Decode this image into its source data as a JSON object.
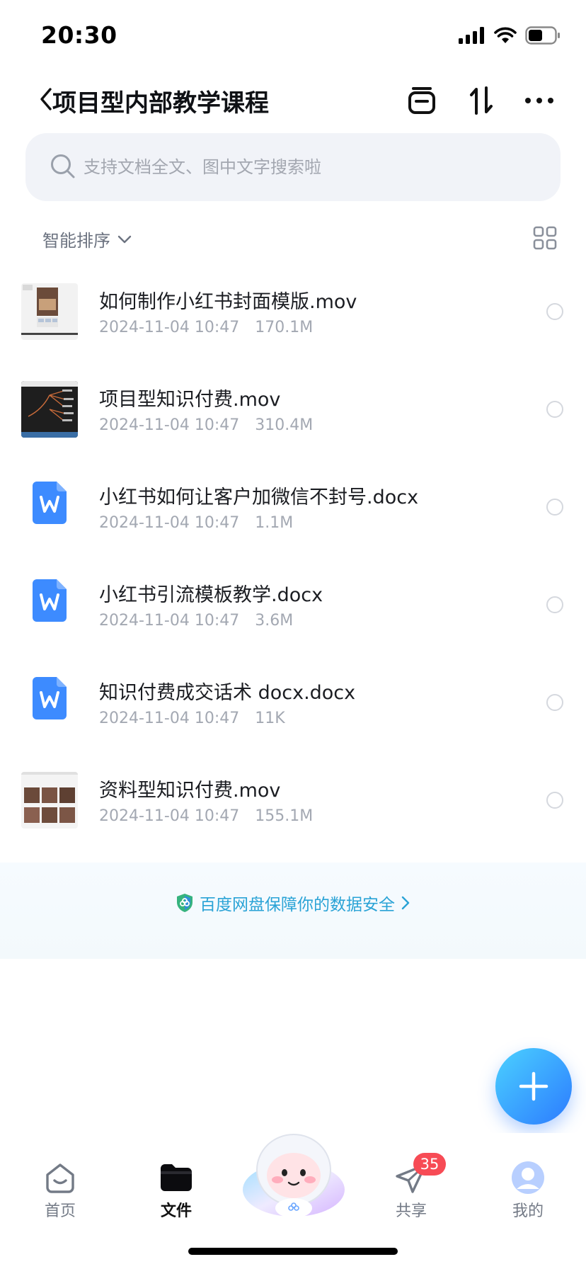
{
  "status_bar": {
    "time": "20:30",
    "battery_percent": 50,
    "icons": [
      "signal-icon",
      "wifi-icon",
      "battery-icon"
    ]
  },
  "header": {
    "title": "项目型内部教学课程",
    "buttons": [
      "back-icon",
      "transfer-icon",
      "sort-icon",
      "more-icon"
    ]
  },
  "search": {
    "placeholder": "支持文档全文、图中文字搜索啦"
  },
  "sort": {
    "label": "智能排序",
    "icons": [
      "chevron-down-icon",
      "grid-view-icon"
    ]
  },
  "files": [
    {
      "name": "如何制作小红书封面模版.mov",
      "date": "2024-11-04 10:47",
      "size": "170.1M",
      "type": "video",
      "icon": "video-thumbnail"
    },
    {
      "name": "项目型知识付费.mov",
      "date": "2024-11-04 10:47",
      "size": "310.4M",
      "type": "video",
      "icon": "video-thumbnail"
    },
    {
      "name": "小红书如何让客户加微信不封号.docx",
      "date": "2024-11-04 10:47",
      "size": "1.1M",
      "type": "docx",
      "icon": "word-doc-icon"
    },
    {
      "name": "小红书引流模板教学.docx",
      "date": "2024-11-04 10:47",
      "size": "3.6M",
      "type": "docx",
      "icon": "word-doc-icon"
    },
    {
      "name": "知识付费成交话术 docx.docx",
      "date": "2024-11-04 10:47",
      "size": "11K",
      "type": "docx",
      "icon": "word-doc-icon"
    },
    {
      "name": "资料型知识付费.mov",
      "date": "2024-11-04 10:47",
      "size": "155.1M",
      "type": "video",
      "icon": "video-thumbnail"
    }
  ],
  "security_banner": {
    "text": "百度网盘保障你的数据安全",
    "icons": [
      "shield-icon",
      "chevron-right-icon"
    ]
  },
  "fab": {
    "icon": "plus-icon"
  },
  "tabs": [
    {
      "label": "首页",
      "icon": "home-icon",
      "active": false
    },
    {
      "label": "文件",
      "icon": "folder-icon",
      "active": true
    },
    {
      "label": "",
      "icon": "mascot-icon",
      "active": false
    },
    {
      "label": "共享",
      "icon": "share-icon",
      "active": false,
      "badge": "35"
    },
    {
      "label": "我的",
      "icon": "profile-icon",
      "active": false
    }
  ],
  "colors": {
    "accent": "#2c7bff",
    "link": "#2aa3d6",
    "badge": "#f74b55",
    "word_blue": "#3d8bff"
  }
}
